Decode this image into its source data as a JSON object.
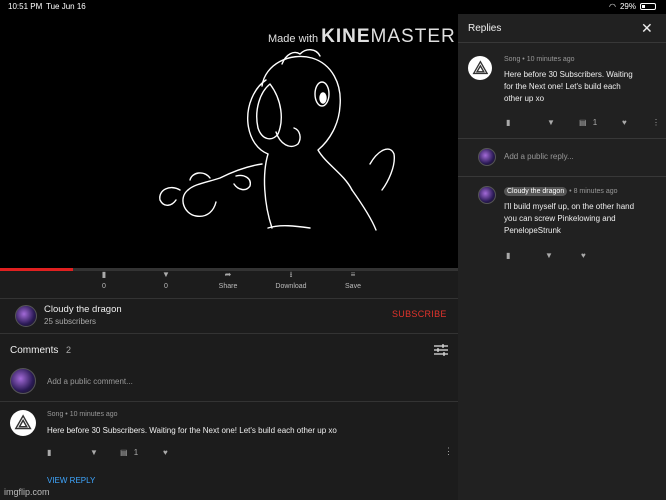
{
  "status_bar": {
    "time": "10:51 PM",
    "date": "Tue Jun 16",
    "battery": "29%"
  },
  "video": {
    "watermark_prefix": "Made with",
    "watermark_brand_bold": "KINE",
    "watermark_brand_rest": "MASTER",
    "progress_fraction": 0.16
  },
  "actions": [
    {
      "icon": "like-icon",
      "label": "0"
    },
    {
      "icon": "dislike-icon",
      "label": "0"
    },
    {
      "icon": "share-icon",
      "label": "Share"
    },
    {
      "icon": "download-icon",
      "label": "Download"
    },
    {
      "icon": "save-icon",
      "label": "Save"
    }
  ],
  "channel": {
    "name": "Cloudy the dragon",
    "subscribers": "25 subscribers",
    "subscribe_label": "SUBSCRIBE"
  },
  "comments": {
    "title": "Comments",
    "count": "2",
    "add_placeholder": "Add a public comment...",
    "items": [
      {
        "author": "Song",
        "time": "10 minutes ago",
        "text": "Here before 30 Subscribers. Waiting for the Next one! Let's build each other up xo",
        "reply_count": "1",
        "view_reply": "VIEW REPLY"
      }
    ]
  },
  "replies_panel": {
    "title": "Replies",
    "original": {
      "author": "Song",
      "time": "10 minutes ago",
      "text_lines": [
        "Here before 30 Subscribers. Waiting",
        "for the Next one! Let's build each",
        "other up xo"
      ],
      "reply_count": "1"
    },
    "add_placeholder": "Add a public reply...",
    "reply": {
      "author": "Cloudy the dragon",
      "time": "8 minutes ago",
      "text_lines": [
        "I'll build myself up, on the other hand",
        "you can screw Pinkelowing and",
        "PenelopeStrunk"
      ]
    }
  },
  "footer": {
    "watermark": "imgflip.com"
  },
  "colors": {
    "accent_red": "#e0332b",
    "link_blue": "#3ea6ff",
    "panel_bg": "#1c1c1c",
    "replies_bg": "#212121"
  }
}
